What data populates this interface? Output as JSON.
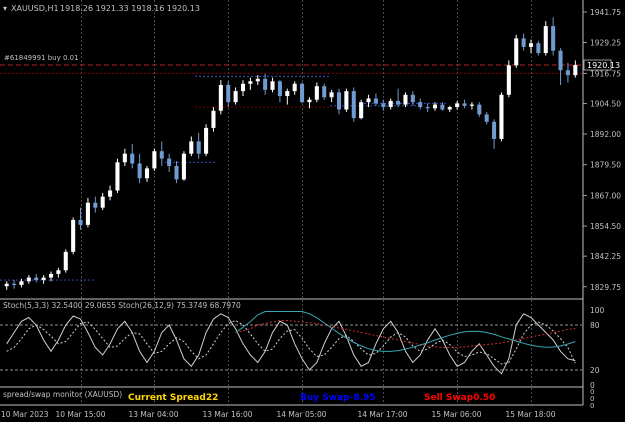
{
  "header": {
    "symbol_label": "XAUUSD,H1",
    "ohlc_text": "1918.26 1921.33 1918.16 1920.13"
  },
  "order_label": "#61849991 buy 0.01",
  "price_axis": {
    "ticks": [
      "1941.75",
      "1929.25",
      "1916.75",
      "1904.50",
      "1892.00",
      "1879.50",
      "1867.00",
      "1854.50",
      "1842.25",
      "1829.75"
    ],
    "current_price": "1920.13"
  },
  "stoch_panel": {
    "title": "Stoch(5,3,3) 32.5400 29.0655  Stoch(26,12,9) 75.3749 68.7970",
    "levels": [
      "100",
      "80",
      "20",
      "0"
    ]
  },
  "spread_panel": {
    "title": "spread/swap monitor (XAUUSD)",
    "current_spread": "Current Spread22",
    "buy_swap": "Buy Swap-8.95",
    "sell_swap": "Sell Swap0.50",
    "axis_labels": [
      "0",
      "0",
      "0"
    ],
    "colors": {
      "spread": "#ffd700",
      "buy": "#0000ff",
      "sell": "#ff0000"
    }
  },
  "time_axis": {
    "labels": [
      "10 Mar 2023",
      "10 Mar 15:00",
      "13 Mar 04:00",
      "13 Mar 16:00",
      "14 Mar 05:00",
      "14 Mar 17:00",
      "15 Mar 06:00",
      "15 Mar 18:00"
    ]
  },
  "chart_data": {
    "type": "candlestick",
    "symbol": "XAUUSD",
    "timeframe": "H1",
    "ylim": [
      1826,
      1945
    ],
    "candles": [
      [
        1830.0,
        1832.0,
        1828.5,
        1831.0
      ],
      [
        1831.0,
        1832.5,
        1829.0,
        1830.5
      ],
      [
        1830.5,
        1833.0,
        1829.5,
        1832.0
      ],
      [
        1832.0,
        1834.5,
        1831.0,
        1833.5
      ],
      [
        1833.5,
        1835.0,
        1831.5,
        1832.5
      ],
      [
        1832.5,
        1834.5,
        1831.0,
        1833.5
      ],
      [
        1833.5,
        1836.0,
        1832.0,
        1835.0
      ],
      [
        1835.0,
        1837.5,
        1833.5,
        1836.5
      ],
      [
        1836.5,
        1845.0,
        1835.5,
        1844.0
      ],
      [
        1844.0,
        1858.0,
        1843.0,
        1857.0
      ],
      [
        1857.0,
        1862.0,
        1853.0,
        1855.0
      ],
      [
        1855.0,
        1866.0,
        1854.0,
        1864.0
      ],
      [
        1864.0,
        1866.5,
        1860.0,
        1862.0
      ],
      [
        1862.0,
        1868.0,
        1861.0,
        1866.5
      ],
      [
        1866.5,
        1871.0,
        1865.0,
        1869.0
      ],
      [
        1869.0,
        1882.0,
        1868.0,
        1880.5
      ],
      [
        1880.5,
        1886.0,
        1879.0,
        1884.0
      ],
      [
        1884.0,
        1888.0,
        1878.0,
        1880.0
      ],
      [
        1880.0,
        1884.0,
        1872.0,
        1874.0
      ],
      [
        1874.0,
        1879.0,
        1872.5,
        1878.0
      ],
      [
        1878.0,
        1886.0,
        1877.0,
        1885.0
      ],
      [
        1885.0,
        1889.0,
        1879.0,
        1882.0
      ],
      [
        1882.0,
        1884.0,
        1876.5,
        1879.0
      ],
      [
        1879.0,
        1881.0,
        1872.0,
        1873.5
      ],
      [
        1873.5,
        1885.0,
        1873.0,
        1884.0
      ],
      [
        1884.0,
        1891.0,
        1883.0,
        1889.0
      ],
      [
        1889.0,
        1892.5,
        1882.0,
        1884.0
      ],
      [
        1884.0,
        1896.0,
        1883.0,
        1894.5
      ],
      [
        1894.5,
        1903.0,
        1893.0,
        1901.5
      ],
      [
        1901.5,
        1914.0,
        1900.0,
        1912.0
      ],
      [
        1912.0,
        1913.5,
        1903.0,
        1905.0
      ],
      [
        1905.0,
        1911.0,
        1904.0,
        1909.5
      ],
      [
        1909.5,
        1914.0,
        1907.5,
        1912.5
      ],
      [
        1912.5,
        1915.0,
        1910.0,
        1913.5
      ],
      [
        1913.5,
        1916.0,
        1912.0,
        1914.5
      ],
      [
        1914.5,
        1916.5,
        1908.0,
        1910.0
      ],
      [
        1910.0,
        1915.0,
        1909.0,
        1913.5
      ],
      [
        1913.5,
        1914.0,
        1905.0,
        1907.5
      ],
      [
        1907.5,
        1910.5,
        1904.0,
        1909.5
      ],
      [
        1909.5,
        1913.5,
        1908.0,
        1912.5
      ],
      [
        1912.5,
        1913.0,
        1904.5,
        1905.0
      ],
      [
        1905.0,
        1907.0,
        1902.5,
        1906.0
      ],
      [
        1906.0,
        1913.0,
        1905.0,
        1911.5
      ],
      [
        1911.5,
        1912.5,
        1906.0,
        1907.0
      ],
      [
        1907.0,
        1910.0,
        1905.0,
        1909.0
      ],
      [
        1909.0,
        1910.5,
        1900.0,
        1902.0
      ],
      [
        1902.0,
        1910.5,
        1901.0,
        1909.5
      ],
      [
        1909.5,
        1911.0,
        1897.0,
        1898.5
      ],
      [
        1898.5,
        1906.0,
        1898.0,
        1905.0
      ],
      [
        1905.0,
        1908.0,
        1903.0,
        1906.5
      ],
      [
        1906.5,
        1908.5,
        1903.5,
        1904.5
      ],
      [
        1904.5,
        1906.0,
        1901.5,
        1903.0
      ],
      [
        1903.0,
        1906.5,
        1902.0,
        1905.5
      ],
      [
        1905.5,
        1910.5,
        1903.0,
        1904.0
      ],
      [
        1904.0,
        1909.0,
        1903.0,
        1908.0
      ],
      [
        1908.0,
        1909.5,
        1903.5,
        1905.0
      ],
      [
        1905.0,
        1906.5,
        1902.0,
        1903.0
      ],
      [
        1903.0,
        1904.5,
        1901.0,
        1902.5
      ],
      [
        1902.5,
        1905.0,
        1901.5,
        1904.0
      ],
      [
        1904.0,
        1905.0,
        1901.5,
        1902.0
      ],
      [
        1902.0,
        1903.5,
        1901.0,
        1903.0
      ],
      [
        1903.0,
        1905.5,
        1902.0,
        1904.5
      ],
      [
        1904.5,
        1906.0,
        1902.5,
        1903.5
      ],
      [
        1903.5,
        1905.0,
        1902.0,
        1904.0
      ],
      [
        1904.0,
        1905.0,
        1899.0,
        1900.0
      ],
      [
        1900.0,
        1901.0,
        1896.0,
        1897.0
      ],
      [
        1897.0,
        1898.0,
        1886.0,
        1890.0
      ],
      [
        1890.0,
        1909.0,
        1889.0,
        1908.0
      ],
      [
        1908.0,
        1922.0,
        1907.0,
        1920.0
      ],
      [
        1920.0,
        1932.5,
        1919.0,
        1931.0
      ],
      [
        1931.0,
        1933.0,
        1926.0,
        1927.5
      ],
      [
        1927.5,
        1930.5,
        1925.0,
        1929.0
      ],
      [
        1929.0,
        1930.0,
        1924.0,
        1925.0
      ],
      [
        1925.0,
        1938.0,
        1924.0,
        1936.0
      ],
      [
        1936.0,
        1939.5,
        1924.0,
        1926.0
      ],
      [
        1926.0,
        1927.0,
        1912.0,
        1918.0
      ],
      [
        1918.0,
        1921.0,
        1913.0,
        1916.0
      ],
      [
        1916.0,
        1922.0,
        1915.0,
        1920.13
      ]
    ],
    "horizontal_lines": [
      {
        "price": 1920.13,
        "style": "dashed",
        "color": "#b22222"
      },
      {
        "price": 1916.75,
        "style": "dotted",
        "color": "#8b0000"
      }
    ],
    "stoch_fast": [
      55,
      70,
      85,
      90,
      80,
      60,
      45,
      60,
      80,
      92,
      88,
      70,
      50,
      40,
      55,
      75,
      85,
      70,
      45,
      30,
      45,
      70,
      80,
      60,
      35,
      25,
      40,
      70,
      88,
      95,
      90,
      75,
      55,
      40,
      30,
      45,
      70,
      85,
      80,
      55,
      35,
      20,
      30,
      55,
      75,
      85,
      65,
      40,
      25,
      30,
      55,
      75,
      85,
      70,
      45,
      30,
      40,
      60,
      75,
      60,
      40,
      25,
      30,
      45,
      55,
      40,
      25,
      15,
      35,
      80,
      95,
      90,
      80,
      70,
      60,
      45,
      35,
      32.54
    ],
    "stoch_slow": [
      45,
      50,
      62,
      75,
      80,
      74,
      65,
      55,
      58,
      70,
      82,
      84,
      74,
      62,
      50,
      52,
      62,
      70,
      68,
      55,
      42,
      45,
      55,
      63,
      58,
      45,
      35,
      40,
      55,
      70,
      82,
      86,
      80,
      68,
      55,
      45,
      48,
      62,
      72,
      74,
      62,
      48,
      38,
      40,
      50,
      62,
      66,
      58,
      48,
      40,
      42,
      52,
      64,
      70,
      64,
      52,
      45,
      48,
      55,
      60,
      54,
      44,
      38,
      40,
      44,
      42,
      35,
      28,
      30,
      48,
      68,
      80,
      84,
      80,
      72,
      62,
      50,
      29.07
    ],
    "stoch_slow2": [
      70,
      72,
      75,
      80,
      82,
      84,
      86,
      86,
      85,
      84,
      83,
      82,
      80,
      78,
      76,
      74,
      72,
      70,
      68,
      66,
      64,
      62,
      60,
      58,
      56,
      54,
      52,
      51,
      50,
      50,
      50,
      51,
      52,
      53,
      54,
      55,
      56,
      58,
      60,
      62,
      64,
      66,
      68,
      70,
      72,
      74,
      75.37
    ]
  }
}
